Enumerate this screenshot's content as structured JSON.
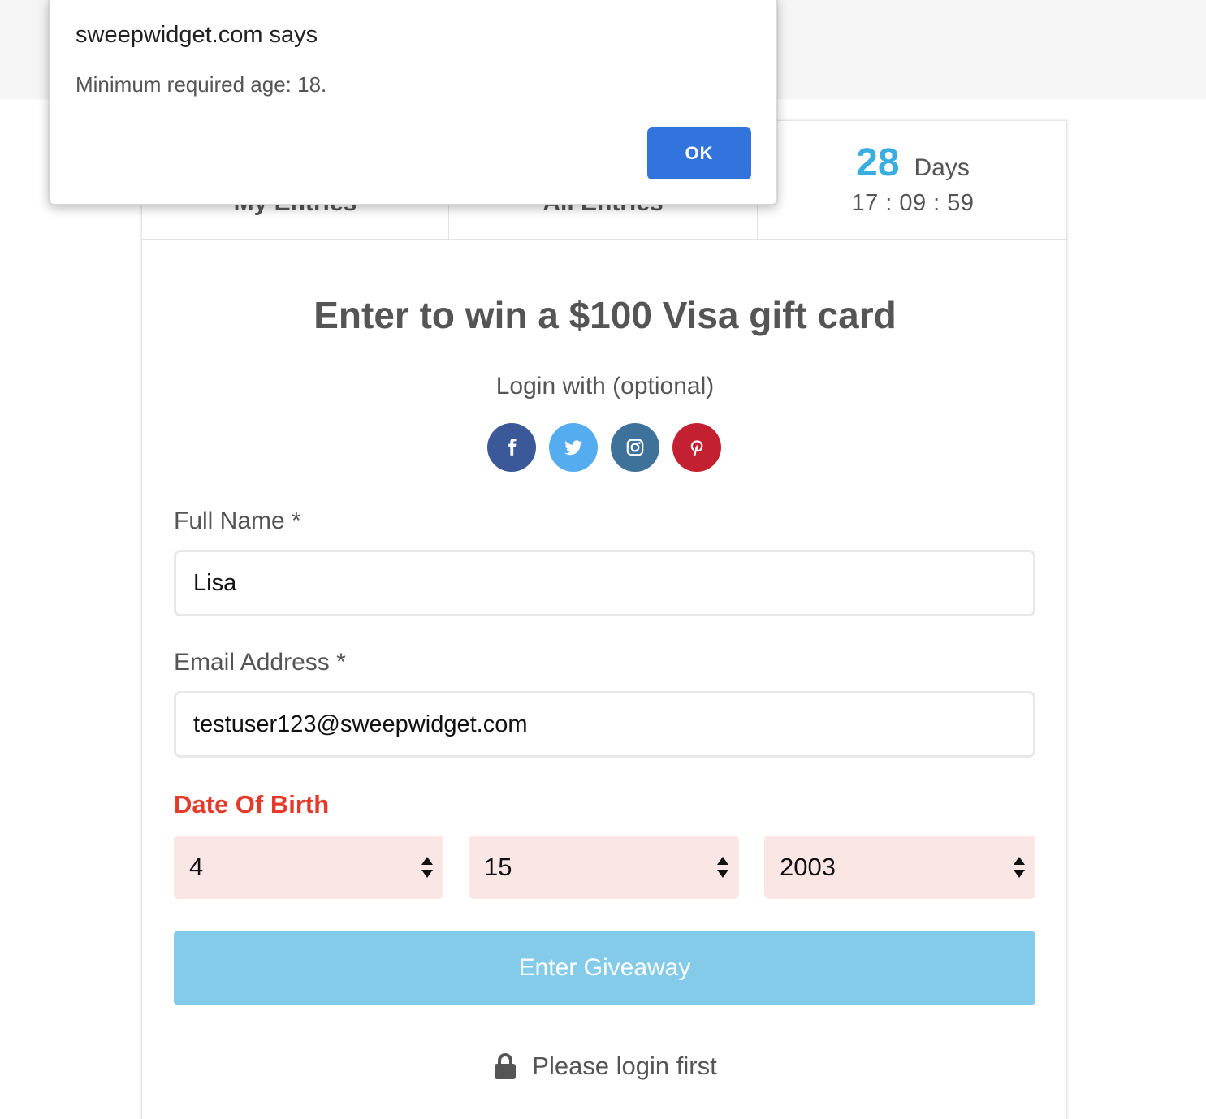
{
  "dialog": {
    "title": "sweepwidget.com says",
    "message": "Minimum required age: 18.",
    "ok_label": "OK"
  },
  "tabs": {
    "my_entries": "My Entries",
    "all_entries": "All Entries"
  },
  "countdown": {
    "days": "28",
    "days_label": "Days",
    "time": "17 : 09 : 59"
  },
  "giveaway": {
    "title": "Enter to win a $100 Visa gift card",
    "login_with": "Login with (optional)"
  },
  "socials": [
    {
      "name": "facebook-icon",
      "color": "#3b5998"
    },
    {
      "name": "twitter-icon",
      "color": "#55acee"
    },
    {
      "name": "instagram-icon",
      "color": "#3f729b"
    },
    {
      "name": "pinterest-icon",
      "color": "#bd081c"
    }
  ],
  "form": {
    "full_name_label": "Full Name *",
    "full_name_value": "Lisa",
    "email_label": "Email Address *",
    "email_value": "testuser123@sweepwidget.com",
    "dob_label": "Date Of Birth",
    "dob_month": "4",
    "dob_day": "15",
    "dob_year": "2003",
    "submit_label": "Enter Giveaway"
  },
  "footer": {
    "login_first": "Please login first"
  },
  "colors": {
    "accent": "#3aaee0",
    "error": "#e53a2a",
    "button": "#84cbea",
    "dialog_button": "#3373de"
  }
}
